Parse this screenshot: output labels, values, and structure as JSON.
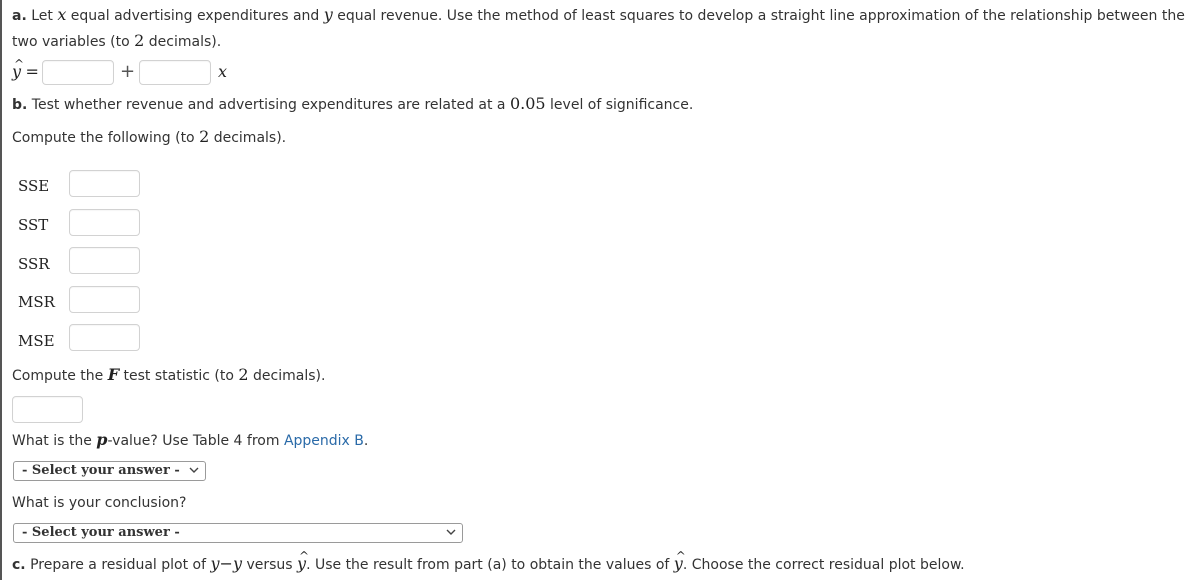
{
  "part_a": {
    "label": "a.",
    "text_1": " Let ",
    "var_x": "x",
    "text_2": " equal advertising expenditures and ",
    "var_y": "y",
    "text_3": " equal revenue. Use the method of least squares to develop a straight line approximation of the relationship between the",
    "line2_text_1": "two variables (to ",
    "line2_num": "2",
    "line2_text_2": " decimals).",
    "equation": {
      "lhs_var": "y",
      "hat": "^",
      "equals": "=",
      "plus": "+",
      "x_var": "x",
      "intercept_value": "",
      "slope_value": ""
    }
  },
  "part_b": {
    "label": "b.",
    "text_1": " Test whether revenue and advertising expenditures are related at a ",
    "alpha": "0.05",
    "text_2": " level of significance.",
    "compute_text_1": "Compute the following (to ",
    "compute_num": "2",
    "compute_text_2": " decimals).",
    "fields": [
      {
        "label": "SSE",
        "value": ""
      },
      {
        "label": "SST",
        "value": ""
      },
      {
        "label": "SSR",
        "value": ""
      },
      {
        "label": "MSR",
        "value": ""
      },
      {
        "label": "MSE",
        "value": ""
      }
    ],
    "f_text_1": "Compute the ",
    "f_var": "F",
    "f_text_2": " test statistic (to ",
    "f_num": "2",
    "f_text_3": " decimals).",
    "f_value": "",
    "p_text_1": "What is the ",
    "p_var": "p",
    "p_text_2": "-value? Use Table 4 from ",
    "p_link": "Appendix B",
    "p_text_3": ".",
    "p_select": "- Select your answer -",
    "conclusion_text": "What is your conclusion?",
    "conclusion_select": "- Select your answer -"
  },
  "part_c": {
    "label": "c.",
    "text_1": " Prepare a residual plot of ",
    "var_y1": "y",
    "minus": "−",
    "var_y2": "y",
    "text_2": " versus ",
    "yhat": "y",
    "hat": "^",
    "text_3": ". Use the result from part (a) to obtain the values of ",
    "yhat2": "y",
    "text_4": ". Choose the correct residual plot below."
  },
  "colors": {
    "link": "#2a6aa8",
    "text": "#333333",
    "input_border": "#d2d2d2",
    "select_border": "#9a9a9a"
  }
}
